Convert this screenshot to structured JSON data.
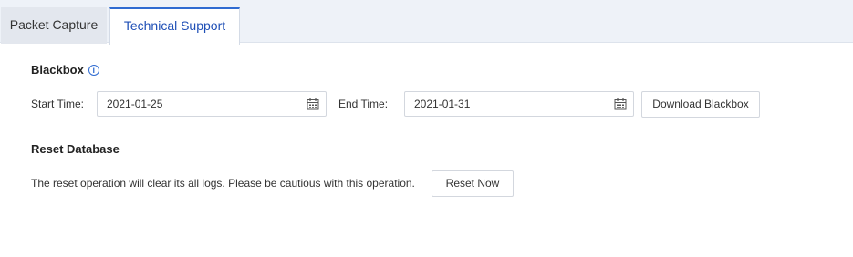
{
  "tabs": [
    {
      "label": "Packet Capture",
      "active": false
    },
    {
      "label": "Technical Support",
      "active": true
    }
  ],
  "blackbox": {
    "title": "Blackbox",
    "info_icon": "info-icon",
    "start_label": "Start Time:",
    "start_value": "2021-01-25",
    "end_label": "End Time:",
    "end_value": "2021-01-31",
    "download_label": "Download Blackbox",
    "calendar_icon": "calendar-icon"
  },
  "reset": {
    "title": "Reset Database",
    "description": "The reset operation will clear its all logs. Please be cautious with this operation.",
    "button_label": "Reset Now"
  },
  "colors": {
    "accent": "#2f6bd1",
    "active_tab_text": "#1f4fb6",
    "tabbar_bg": "#eef2f8"
  }
}
